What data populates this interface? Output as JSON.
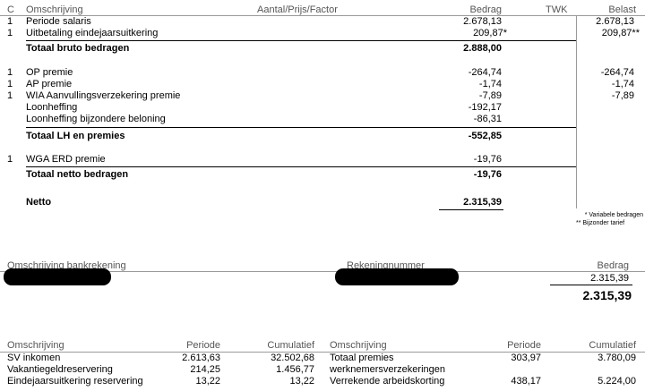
{
  "header": {
    "col_c": "C",
    "col_desc": "Omschrijving",
    "col_factor": "Aantal/Prijs/Factor",
    "col_amount": "Bedrag",
    "col_twk": "TWK",
    "col_taxed": "Belast"
  },
  "gross": {
    "rows": [
      {
        "c": "1",
        "desc": "Periode salaris",
        "amount": "2.678,13",
        "taxed": "2.678,13"
      },
      {
        "c": "1",
        "desc": "Uitbetaling eindejaarsuitkering",
        "amount": "209,87*",
        "taxed": "209,87**"
      }
    ],
    "total_label": "Totaal bruto bedragen",
    "total_amount": "2.888,00"
  },
  "premiums": {
    "rows": [
      {
        "c": "1",
        "desc": "OP premie",
        "amount": "-264,74",
        "taxed": "-264,74"
      },
      {
        "c": "1",
        "desc": "AP premie",
        "amount": "-1,74",
        "taxed": "-1,74"
      },
      {
        "c": "1",
        "desc": "WIA Aanvullingsverzekering premie",
        "amount": "-7,89",
        "taxed": "-7,89"
      },
      {
        "c": "",
        "desc": "Loonheffing",
        "amount": "-192,17",
        "taxed": ""
      },
      {
        "c": "",
        "desc": "Loonheffing bijzondere beloning",
        "amount": "-86,31",
        "taxed": ""
      }
    ],
    "total_label": "Totaal LH en premies",
    "total_amount": "-552,85"
  },
  "net_items": {
    "rows": [
      {
        "c": "1",
        "desc": "WGA ERD premie",
        "amount": "-19,76",
        "taxed": ""
      }
    ],
    "total_label": "Totaal netto bedragen",
    "total_amount": "-19,76"
  },
  "net": {
    "label": "Netto",
    "amount": "2.315,39"
  },
  "footnotes": {
    "variable": "* Variabele bedragen",
    "special": "** Bijzonder tarief"
  },
  "bank": {
    "col_desc": "Omschrijving bankrekening",
    "col_number": "Rekeningnummer",
    "col_amount": "Bedrag",
    "amount": "2.315,39",
    "total": "2.315,39"
  },
  "summary": {
    "left_header": {
      "desc": "Omschrijving",
      "period": "Periode",
      "cumulative": "Cumulatief"
    },
    "right_header": {
      "desc": "Omschrijving",
      "period": "Periode",
      "cumulative": "Cumulatief"
    },
    "left_rows": [
      {
        "desc": "SV inkomen",
        "period": "2.613,63",
        "cumulative": "32.502,68"
      },
      {
        "desc": "Vakantiegeldreservering",
        "period": "214,25",
        "cumulative": "1.456,77"
      },
      {
        "desc": "Eindejaarsuitkering reservering",
        "period": "13,22",
        "cumulative": "13,22"
      }
    ],
    "right_rows": [
      {
        "desc": "Totaal premies",
        "period": "303,97",
        "cumulative": "3.780,09"
      },
      {
        "desc": "werknemersverzekeringen",
        "period": "",
        "cumulative": ""
      },
      {
        "desc": "Verrekende arbeidskorting",
        "period": "438,17",
        "cumulative": "5.224,00"
      }
    ]
  }
}
